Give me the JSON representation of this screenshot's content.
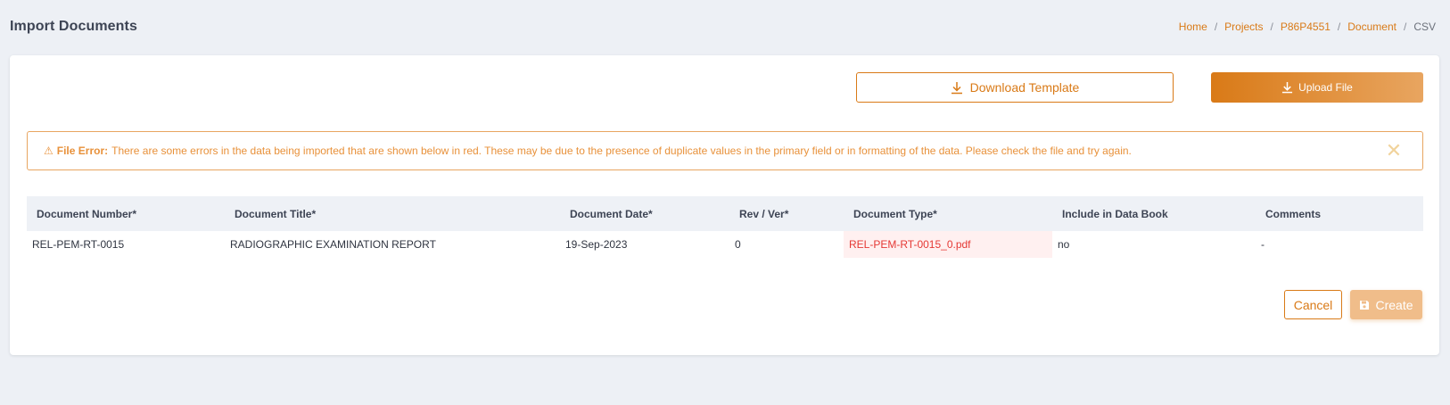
{
  "header": {
    "title": "Import Documents",
    "breadcrumb": [
      {
        "label": "Home",
        "link": true
      },
      {
        "label": "Projects",
        "link": true
      },
      {
        "label": "P86P4551",
        "link": true
      },
      {
        "label": "Document",
        "link": true
      },
      {
        "label": "CSV",
        "link": false
      }
    ]
  },
  "toolbar": {
    "download_label": "Download Template",
    "upload_label": "Upload File"
  },
  "alert": {
    "icon": "⚠",
    "title": "File Error:",
    "message": "There are some errors in the data being imported that are shown below in red. These may be due to the presence of duplicate values in the primary field or in formatting of the data. Please check the file and try again.",
    "close": "✕"
  },
  "table": {
    "columns": [
      "Document Number*",
      "Document Title*",
      "Document Date*",
      "Rev / Ver*",
      "Document Type*",
      "Include in Data Book",
      "Comments"
    ],
    "rows": [
      [
        "REL-PEM-RT-0015",
        "RADIOGRAPHIC EXAMINATION REPORT",
        "19-Sep-2023",
        "0",
        "REL-PEM-RT-0015_0.pdf",
        "no",
        "-"
      ]
    ]
  },
  "actions": {
    "cancel_label": "Cancel",
    "create_label": "Create"
  },
  "colors": {
    "accent": "#d97a17",
    "error_text": "#e53935",
    "error_bg": "#fff0f0"
  }
}
